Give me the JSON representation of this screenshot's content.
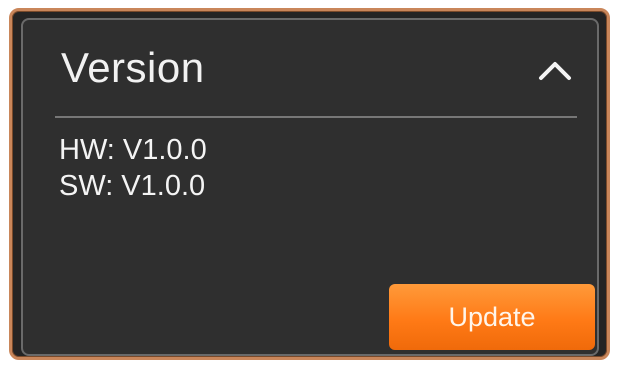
{
  "panel": {
    "title": "Version",
    "collapse_icon": "chevron-up-icon",
    "hardware_version": "HW: V1.0.0",
    "software_version": "SW: V1.0.0",
    "update_label": "Update"
  },
  "colors": {
    "accent": "#ff7a16",
    "panel_background": "#2f2f2f",
    "text": "#f2f2f2"
  }
}
